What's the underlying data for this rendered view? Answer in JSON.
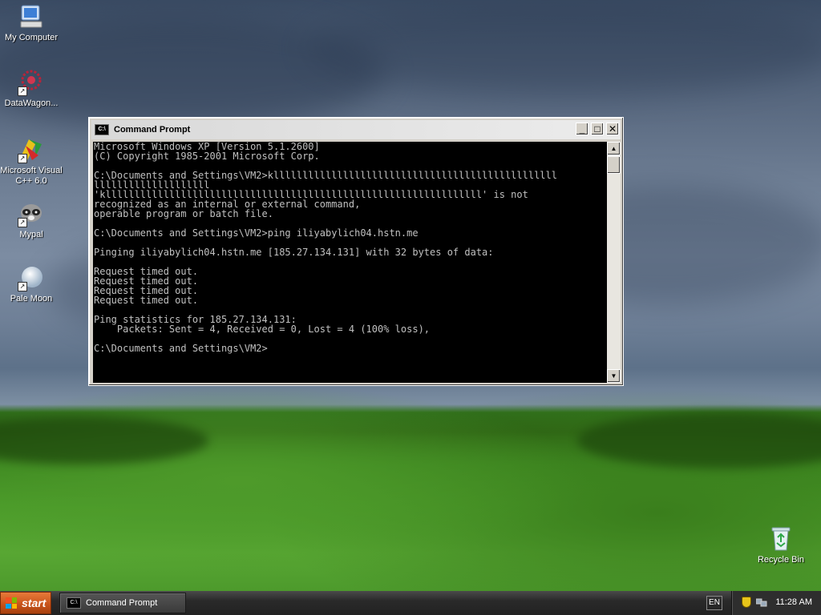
{
  "desktop": {
    "icons": [
      {
        "label": "My Computer",
        "icon": "my-computer-icon"
      },
      {
        "label": "DataWagon...",
        "icon": "datawagon-icon"
      },
      {
        "label": "Microsoft Visual C++ 6.0",
        "icon": "visual-cpp-icon"
      },
      {
        "label": "Mypal",
        "icon": "mypal-icon"
      },
      {
        "label": "Pale Moon",
        "icon": "pale-moon-icon"
      },
      {
        "label": "Recycle Bin",
        "icon": "recycle-bin-icon"
      }
    ]
  },
  "window": {
    "title": "Command Prompt",
    "icon_text": "C:\\",
    "buttons": {
      "minimize": "_",
      "maximize": "□",
      "close": "✕"
    },
    "console_lines": [
      "Microsoft Windows XP [Version 5.1.2600]",
      "(C) Copyright 1985-2001 Microsoft Corp.",
      "",
      "C:\\Documents and Settings\\VM2>klllllllllllllllllllllllllllllllllllllllllllllllll",
      "llllllllllllllllllll",
      "'klllllllllllllllllllllllllllllllllllllllllllllllllllllllllllllllll' is not",
      "recognized as an internal or external command,",
      "operable program or batch file.",
      "",
      "C:\\Documents and Settings\\VM2>ping iliyabylich04.hstn.me",
      "",
      "Pinging iliyabylich04.hstn.me [185.27.134.131] with 32 bytes of data:",
      "",
      "Request timed out.",
      "Request timed out.",
      "Request timed out.",
      "Request timed out.",
      "",
      "Ping statistics for 185.27.134.131:",
      "    Packets: Sent = 4, Received = 0, Lost = 4 (100% loss),",
      "",
      "C:\\Documents and Settings\\VM2>"
    ],
    "scroll": {
      "up": "▲",
      "down": "▼"
    }
  },
  "taskbar": {
    "start_label": "start",
    "task_label": "Command Prompt",
    "language": "EN",
    "clock": "11:28 AM"
  },
  "colors": {
    "console_bg": "#000000",
    "console_fg": "#c0c0c0",
    "start_orange": "#c9541b"
  }
}
